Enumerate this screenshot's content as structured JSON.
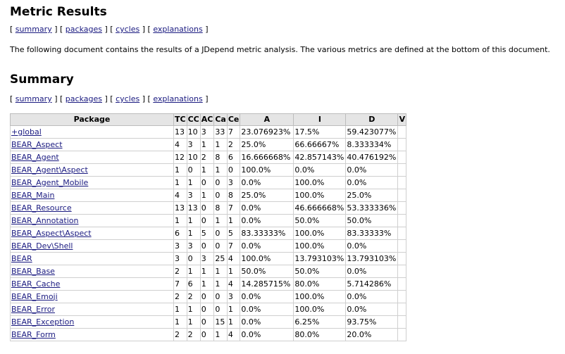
{
  "title": "Metric Results",
  "nav": {
    "summary": "summary",
    "packages": "packages",
    "cycles": "cycles",
    "explanations": "explanations",
    "open": "[",
    "sep": "] [",
    "close": "]"
  },
  "intro": "The following document contains the results of a JDepend metric analysis. The various metrics are defined at the bottom of this document.",
  "summary": {
    "heading": "Summary",
    "columns": [
      "Package",
      "TC",
      "CC",
      "AC",
      "Ca",
      "Ce",
      "A",
      "I",
      "D",
      "V"
    ],
    "rows": [
      {
        "package": "+global",
        "tc": "13",
        "cc": "10",
        "ac": "3",
        "ca": "33",
        "ce": "7",
        "a": "23.076923%",
        "i": "17.5%",
        "d": "59.423077%",
        "v": ""
      },
      {
        "package": "BEAR_Aspect",
        "tc": "4",
        "cc": "3",
        "ac": "1",
        "ca": "1",
        "ce": "2",
        "a": "25.0%",
        "i": "66.66667%",
        "d": "8.333334%",
        "v": ""
      },
      {
        "package": "BEAR_Agent",
        "tc": "12",
        "cc": "10",
        "ac": "2",
        "ca": "8",
        "ce": "6",
        "a": "16.666668%",
        "i": "42.857143%",
        "d": "40.476192%",
        "v": ""
      },
      {
        "package": "BEAR_Agent\\Aspect",
        "tc": "1",
        "cc": "0",
        "ac": "1",
        "ca": "1",
        "ce": "0",
        "a": "100.0%",
        "i": "0.0%",
        "d": "0.0%",
        "v": ""
      },
      {
        "package": "BEAR_Agent_Mobile",
        "tc": "1",
        "cc": "1",
        "ac": "0",
        "ca": "0",
        "ce": "3",
        "a": "0.0%",
        "i": "100.0%",
        "d": "0.0%",
        "v": ""
      },
      {
        "package": "BEAR_Main",
        "tc": "4",
        "cc": "3",
        "ac": "1",
        "ca": "0",
        "ce": "8",
        "a": "25.0%",
        "i": "100.0%",
        "d": "25.0%",
        "v": ""
      },
      {
        "package": "BEAR_Resource",
        "tc": "13",
        "cc": "13",
        "ac": "0",
        "ca": "8",
        "ce": "7",
        "a": "0.0%",
        "i": "46.666668%",
        "d": "53.333336%",
        "v": ""
      },
      {
        "package": "BEAR_Annotation",
        "tc": "1",
        "cc": "1",
        "ac": "0",
        "ca": "1",
        "ce": "1",
        "a": "0.0%",
        "i": "50.0%",
        "d": "50.0%",
        "v": ""
      },
      {
        "package": "BEAR_Aspect\\Aspect",
        "tc": "6",
        "cc": "1",
        "ac": "5",
        "ca": "0",
        "ce": "5",
        "a": "83.33333%",
        "i": "100.0%",
        "d": "83.33333%",
        "v": ""
      },
      {
        "package": "BEAR_Dev\\Shell",
        "tc": "3",
        "cc": "3",
        "ac": "0",
        "ca": "0",
        "ce": "7",
        "a": "0.0%",
        "i": "100.0%",
        "d": "0.0%",
        "v": ""
      },
      {
        "package": "BEAR",
        "tc": "3",
        "cc": "0",
        "ac": "3",
        "ca": "25",
        "ce": "4",
        "a": "100.0%",
        "i": "13.793103%",
        "d": "13.793103%",
        "v": ""
      },
      {
        "package": "BEAR_Base",
        "tc": "2",
        "cc": "1",
        "ac": "1",
        "ca": "1",
        "ce": "1",
        "a": "50.0%",
        "i": "50.0%",
        "d": "0.0%",
        "v": ""
      },
      {
        "package": "BEAR_Cache",
        "tc": "7",
        "cc": "6",
        "ac": "1",
        "ca": "1",
        "ce": "4",
        "a": "14.285715%",
        "i": "80.0%",
        "d": "5.714286%",
        "v": ""
      },
      {
        "package": "BEAR_Emoji",
        "tc": "2",
        "cc": "2",
        "ac": "0",
        "ca": "0",
        "ce": "3",
        "a": "0.0%",
        "i": "100.0%",
        "d": "0.0%",
        "v": ""
      },
      {
        "package": "BEAR_Error",
        "tc": "1",
        "cc": "1",
        "ac": "0",
        "ca": "0",
        "ce": "1",
        "a": "0.0%",
        "i": "100.0%",
        "d": "0.0%",
        "v": ""
      },
      {
        "package": "BEAR_Exception",
        "tc": "1",
        "cc": "1",
        "ac": "0",
        "ca": "15",
        "ce": "1",
        "a": "0.0%",
        "i": "6.25%",
        "d": "93.75%",
        "v": ""
      },
      {
        "package": "BEAR_Form",
        "tc": "2",
        "cc": "2",
        "ac": "0",
        "ca": "1",
        "ce": "4",
        "a": "0.0%",
        "i": "80.0%",
        "d": "20.0%",
        "v": ""
      }
    ]
  }
}
